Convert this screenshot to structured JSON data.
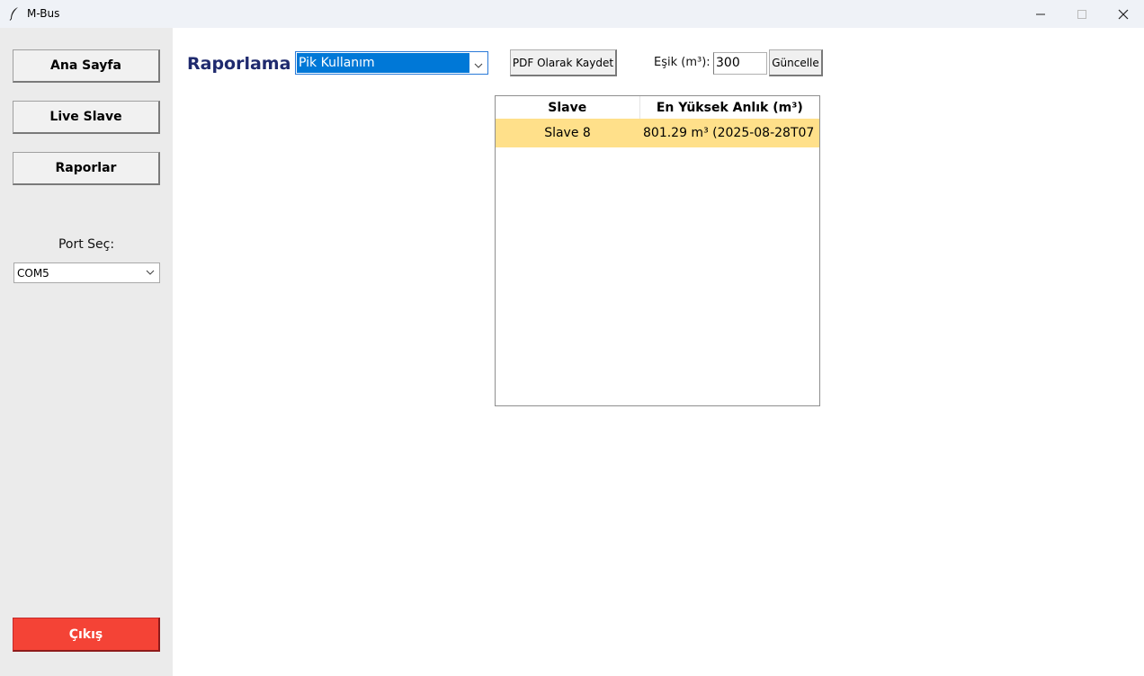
{
  "window": {
    "title": "M-Bus",
    "icon": "feather-icon",
    "controls": [
      "minimize-icon",
      "maximize-icon",
      "close-icon"
    ]
  },
  "sidebar": {
    "items": [
      {
        "label": "Ana Sayfa"
      },
      {
        "label": "Live Slave"
      },
      {
        "label": "Raporlar"
      }
    ],
    "port_label": "Port Seç:",
    "port_value": "COM5",
    "exit_label": "Çıkış",
    "exit_color": "#f44336"
  },
  "main": {
    "title": "Raporlama",
    "title_color": "#1f2a6e",
    "report_type": "Pik Kullanım",
    "pdf_button": "PDF Olarak Kaydet",
    "threshold_label": "Eşik (m³):",
    "threshold_value": "300",
    "update_button": "Güncelle"
  },
  "table": {
    "columns": [
      "Slave",
      "En Yüksek Anlık (m³)"
    ],
    "rows": [
      {
        "slave": "Slave 8",
        "peak": "801.29 m³ (2025-08-28T07",
        "highlight": "#ffe08a"
      }
    ]
  }
}
